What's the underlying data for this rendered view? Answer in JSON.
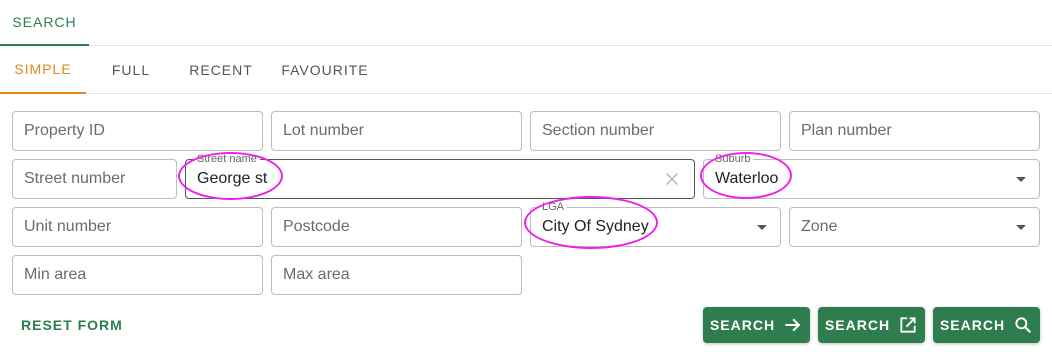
{
  "top_tab": {
    "label": "SEARCH"
  },
  "sub_tabs": [
    {
      "label": "SIMPLE",
      "active": true
    },
    {
      "label": "FULL"
    },
    {
      "label": "RECENT"
    },
    {
      "label": "FAVOURITE"
    }
  ],
  "fields": {
    "property_id": {
      "placeholder": "Property ID"
    },
    "lot_number": {
      "placeholder": "Lot number"
    },
    "section_number": {
      "placeholder": "Section number"
    },
    "plan_number": {
      "placeholder": "Plan number"
    },
    "street_number": {
      "placeholder": "Street number"
    },
    "street_name": {
      "label": "Street name",
      "value": "George st"
    },
    "suburb": {
      "label": "Suburb",
      "value": "Waterloo"
    },
    "unit_number": {
      "placeholder": "Unit number"
    },
    "postcode": {
      "placeholder": "Postcode"
    },
    "lga": {
      "label": "LGA",
      "value": "City Of Sydney"
    },
    "zone": {
      "placeholder": "Zone"
    },
    "min_area": {
      "placeholder": "Min area"
    },
    "max_area": {
      "placeholder": "Max area"
    }
  },
  "actions": {
    "reset_label": "RESET FORM",
    "buttons": [
      {
        "label": "SEARCH",
        "icon": "arrow-right-icon"
      },
      {
        "label": "SEARCH",
        "icon": "open-in-new-icon"
      },
      {
        "label": "SEARCH",
        "icon": "magnifier-icon"
      }
    ]
  },
  "colors": {
    "accent_green": "#2e7d4f",
    "active_tab": "#e08a1e",
    "highlight": "#ee1fee"
  }
}
